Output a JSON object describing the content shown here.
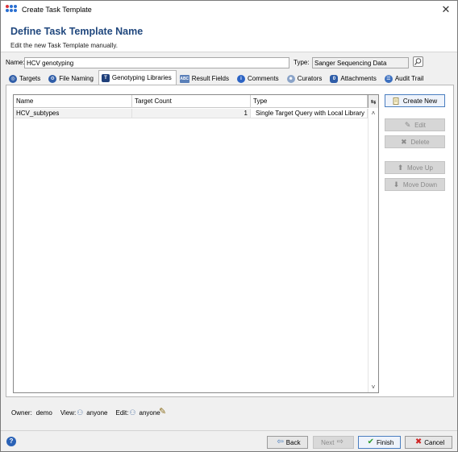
{
  "window": {
    "title": "Create Task Template",
    "close_glyph": "✕"
  },
  "header": {
    "title": "Define Task Template Name",
    "subtitle": "Edit the new Task Template manually."
  },
  "form": {
    "name_label": "Name:",
    "name_value": "HCV genotyping",
    "type_label": "Type:",
    "type_value": "Sanger Sequencing Data"
  },
  "tabs": [
    {
      "label": "Targets",
      "icon": "targets-icon"
    },
    {
      "label": "File Naming",
      "icon": "file-naming-icon"
    },
    {
      "label": "Genotyping Libraries",
      "icon": "genotyping-libraries-icon"
    },
    {
      "label": "Result Fields",
      "icon": "result-fields-icon"
    },
    {
      "label": "Comments",
      "icon": "info-icon"
    },
    {
      "label": "Curators",
      "icon": "curators-icon"
    },
    {
      "label": "Attachments",
      "icon": "attachments-icon"
    },
    {
      "label": "Audit Trail",
      "icon": "audit-trail-icon"
    }
  ],
  "table": {
    "columns": [
      "Name",
      "Target Count",
      "Type"
    ],
    "rows": [
      {
        "name": "HCV_subtypes",
        "target_count": "1",
        "type": "Single Target Query with Local Library"
      }
    ]
  },
  "actions": {
    "create_new": "Create New",
    "edit": "Edit",
    "delete": "Delete",
    "move_up": "Move Up",
    "move_down": "Move Down"
  },
  "permissions": {
    "owner_label": "Owner:",
    "owner_value": "demo",
    "view_label": "View:",
    "view_value": "anyone",
    "edit_label": "Edit:",
    "edit_value": "anyone"
  },
  "footer": {
    "help_glyph": "?",
    "back": "Back",
    "next": "Next",
    "finish": "Finish",
    "cancel": "Cancel"
  },
  "colors": {
    "header_title": "#21487e",
    "primary_border": "#4a7ec0",
    "finish_check": "#2e9b2e",
    "cancel_x": "#d02424"
  }
}
